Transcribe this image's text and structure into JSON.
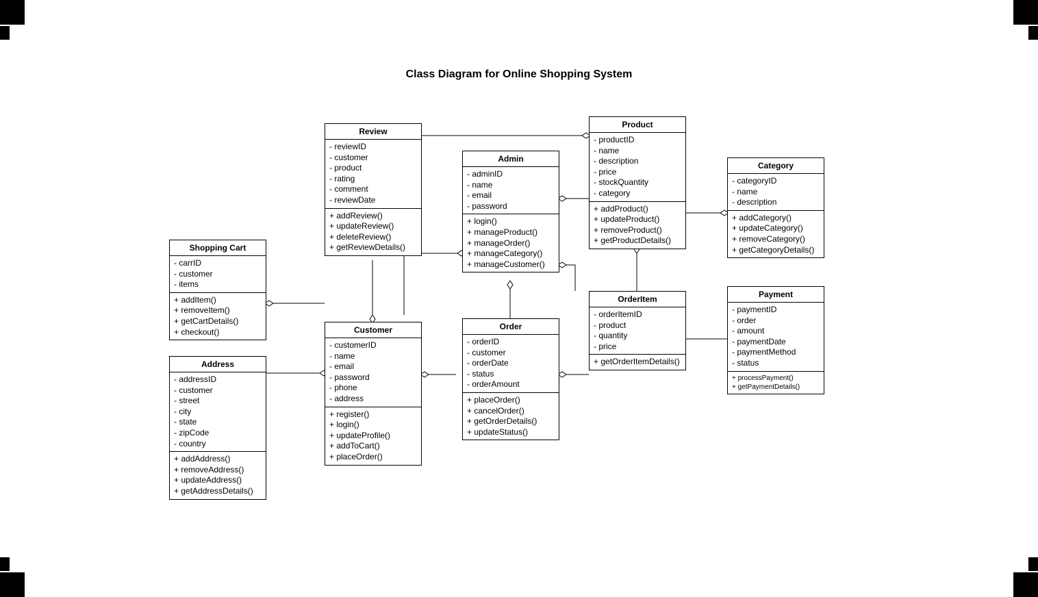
{
  "title": "Class Diagram for Online Shopping System",
  "classes": {
    "review": {
      "name": "Review",
      "attrs": [
        "- reviewID",
        "- customer",
        "- product",
        "- rating",
        "- comment",
        "- reviewDate"
      ],
      "methods": [
        "+ addReview()",
        "+ updateReview()",
        "+ deleteReview()",
        "+ getReviewDetails()"
      ]
    },
    "product": {
      "name": "Product",
      "attrs": [
        "- productID",
        "- name",
        "- description",
        "- price",
        "- stockQuantity",
        "- category"
      ],
      "methods": [
        "+ addProduct()",
        "+ updateProduct()",
        "+ removeProduct()",
        "+ getProductDetails()"
      ]
    },
    "category": {
      "name": "Category",
      "attrs": [
        "- categoryID",
        "- name",
        "- description"
      ],
      "methods": [
        "+ addCategory()",
        "+ updateCategory()",
        "+ removeCategory()",
        "+ getCategoryDetails()"
      ]
    },
    "admin": {
      "name": "Admin",
      "attrs": [
        "- adminID",
        "- name",
        "- email",
        "- password"
      ],
      "methods": [
        "+ login()",
        "+ manageProduct()",
        "+ manageOrder()",
        "+ manageCategory()",
        "+ manageCustomer()"
      ]
    },
    "shoppingCart": {
      "name": "Shopping Cart",
      "attrs": [
        "- carrID",
        "- customer",
        "- items"
      ],
      "methods": [
        "+ addItem()",
        "+ removeItem()",
        "+ getCartDetails()",
        "+ checkout()"
      ]
    },
    "address": {
      "name": "Address",
      "attrs": [
        "- addressID",
        "- customer",
        "- street",
        "- city",
        "- state",
        "- zipCode",
        "- country"
      ],
      "methods": [
        "+ addAddress()",
        "+ removeAddress()",
        "+ updateAddress()",
        "+ getAddressDetails()"
      ]
    },
    "customer": {
      "name": "Customer",
      "attrs": [
        "- customerID",
        "- name",
        "- email",
        "- password",
        "- phone",
        "- address"
      ],
      "methods": [
        "+ register()",
        "+ login()",
        "+ updateProfile()",
        "+ addToCart()",
        "+ placeOrder()"
      ]
    },
    "order": {
      "name": "Order",
      "attrs": [
        "- orderID",
        "- customer",
        "- orderDate",
        "- status",
        "- orderAmount"
      ],
      "methods": [
        "+ placeOrder()",
        "+ cancelOrder()",
        "+ getOrderDetails()",
        "+ updateStatus()"
      ]
    },
    "orderItem": {
      "name": "OrderItem",
      "attrs": [
        "- orderItemID",
        "- product",
        "- quantity",
        "- price"
      ],
      "methods": [
        "+ getOrderItemDetails()"
      ]
    },
    "payment": {
      "name": "Payment",
      "attrs": [
        "- paymentID",
        "- order",
        "- amount",
        "- paymentDate",
        "- paymentMethod",
        "- status"
      ],
      "methods": [
        "+ processPayment()",
        "+ getPaymentDetails()"
      ]
    }
  }
}
